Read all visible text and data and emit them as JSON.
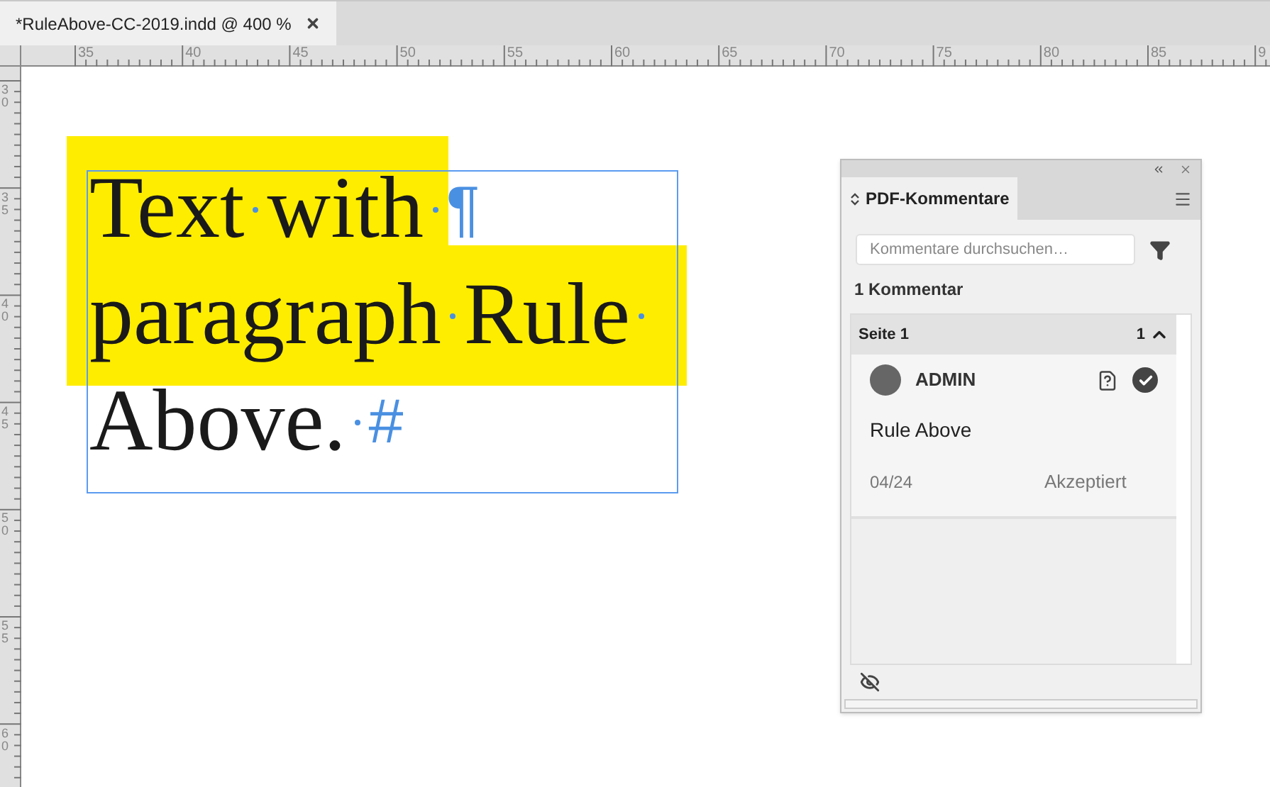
{
  "document_tab": {
    "title": "*RuleAbove-CC-2019.indd @ 400 %"
  },
  "rulers": {
    "horizontal": [
      "35",
      "40",
      "45",
      "50",
      "55",
      "60",
      "65",
      "70",
      "75",
      "80",
      "85",
      "9"
    ],
    "vertical": [
      "30",
      "35",
      "40",
      "45",
      "50",
      "55",
      "60"
    ]
  },
  "text_frame": {
    "lines": [
      {
        "words": [
          "Text",
          "with"
        ],
        "end": "¶"
      },
      {
        "words": [
          "paragraph",
          "Rule"
        ]
      },
      {
        "words": [
          "Above."
        ],
        "end": "#"
      }
    ]
  },
  "panel": {
    "tab": "PDF-Kommentare",
    "search": {
      "placeholder": "Kommentare durchsuchen…"
    },
    "count": "1 Kommentar",
    "groups": [
      {
        "title": "Seite 1",
        "count": "1",
        "expanded": true,
        "comments": [
          {
            "author": "ADMIN",
            "text": "Rule Above",
            "date": "04/24",
            "status": "Akzeptiert",
            "accepted": true
          }
        ]
      }
    ]
  }
}
